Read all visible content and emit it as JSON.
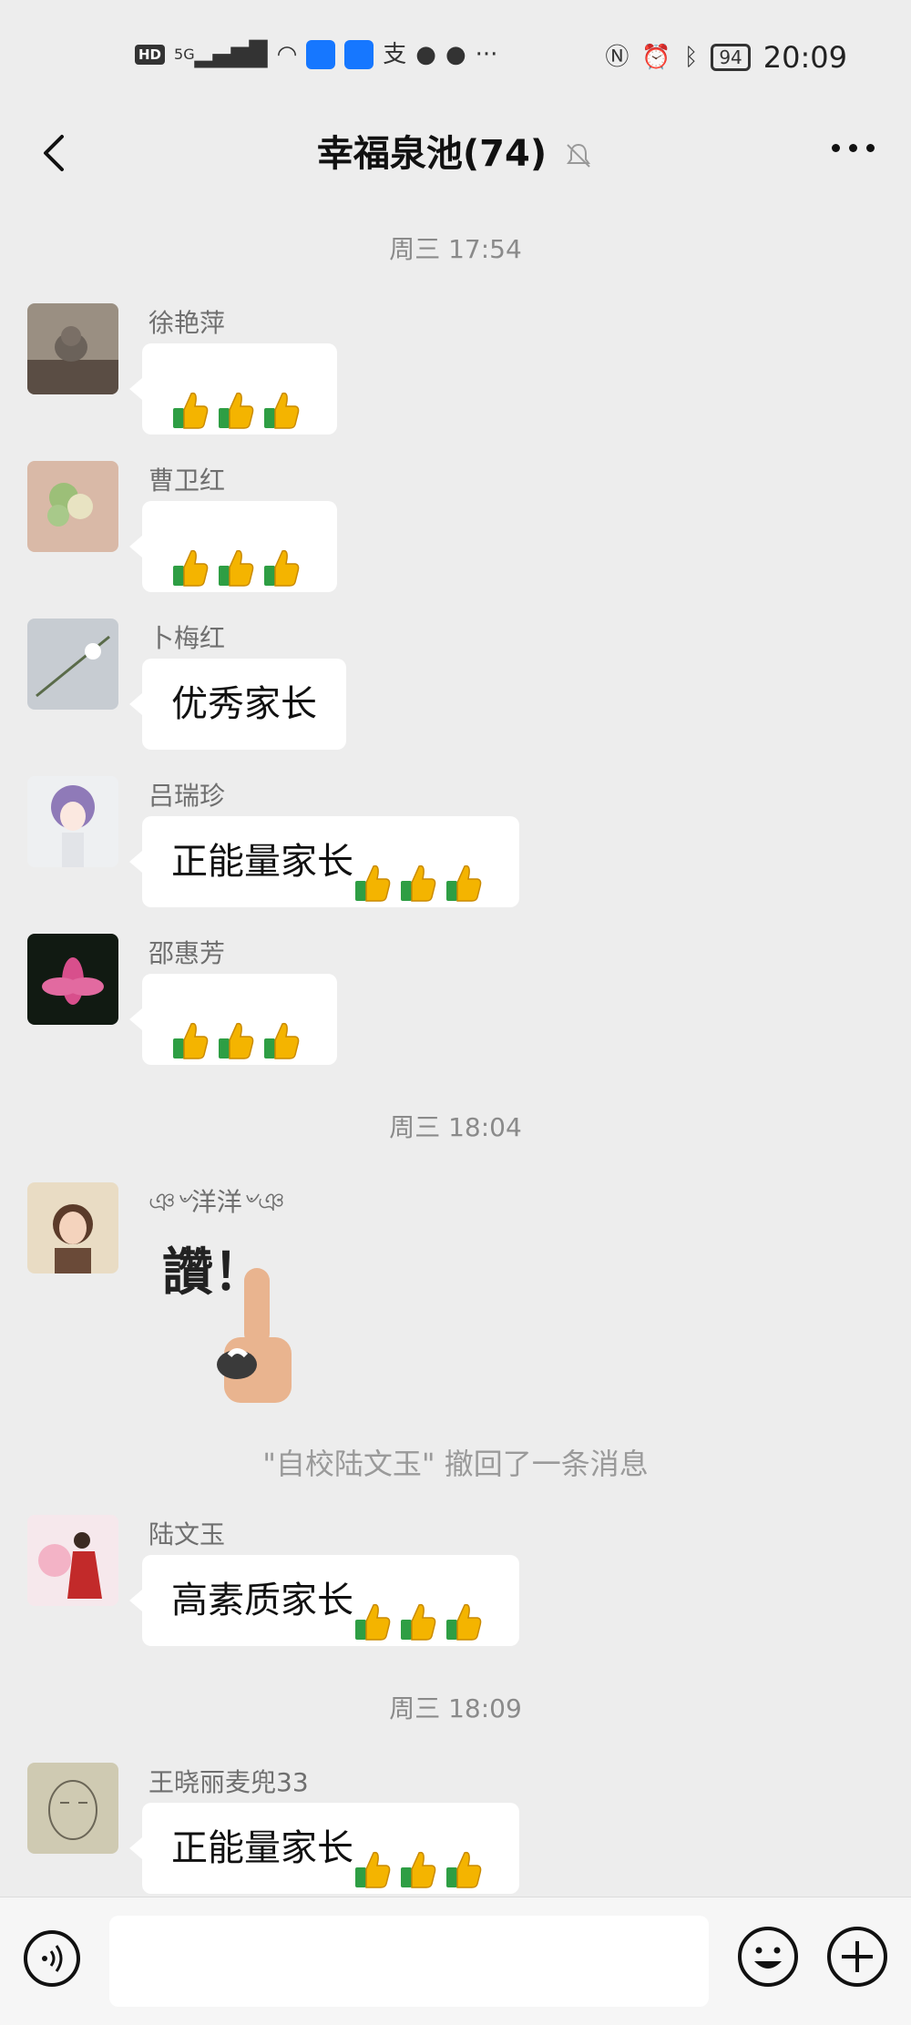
{
  "statusbar": {
    "hd": "HD",
    "signal": "5G",
    "more": "···",
    "battery": "94",
    "time": "20:09"
  },
  "header": {
    "title": "幸福泉池(74)",
    "muted": true
  },
  "timestamps": [
    "周三 17:54",
    "周三 18:04",
    "周三 18:09"
  ],
  "messages": [
    {
      "sender": "徐艳萍",
      "text": "",
      "thumbs": 3
    },
    {
      "sender": "曹卫红",
      "text": "",
      "thumbs": 3
    },
    {
      "sender": "卜梅红",
      "text": "优秀家长",
      "thumbs": 0
    },
    {
      "sender": "吕瑞珍",
      "text": "正能量家长",
      "thumbs": 3
    },
    {
      "sender": "邵惠芳",
      "text": "",
      "thumbs": 3
    },
    {
      "sender": "ঞ৺洋洋৺ঞ",
      "sticker_text": "讚！"
    },
    {
      "sender": "陆文玉",
      "text": "高素质家长",
      "thumbs": 3
    },
    {
      "sender": "王晓丽麦兜33",
      "text": "正能量家长",
      "thumbs": 3
    }
  ],
  "system_message": "\"自校陆文玉\" 撤回了一条消息",
  "input": {
    "value": "",
    "placeholder": ""
  },
  "colors": {
    "background": "#ededed",
    "bubble": "#ffffff",
    "thumb": "#f4b400",
    "cuff": "#2e9e44"
  }
}
